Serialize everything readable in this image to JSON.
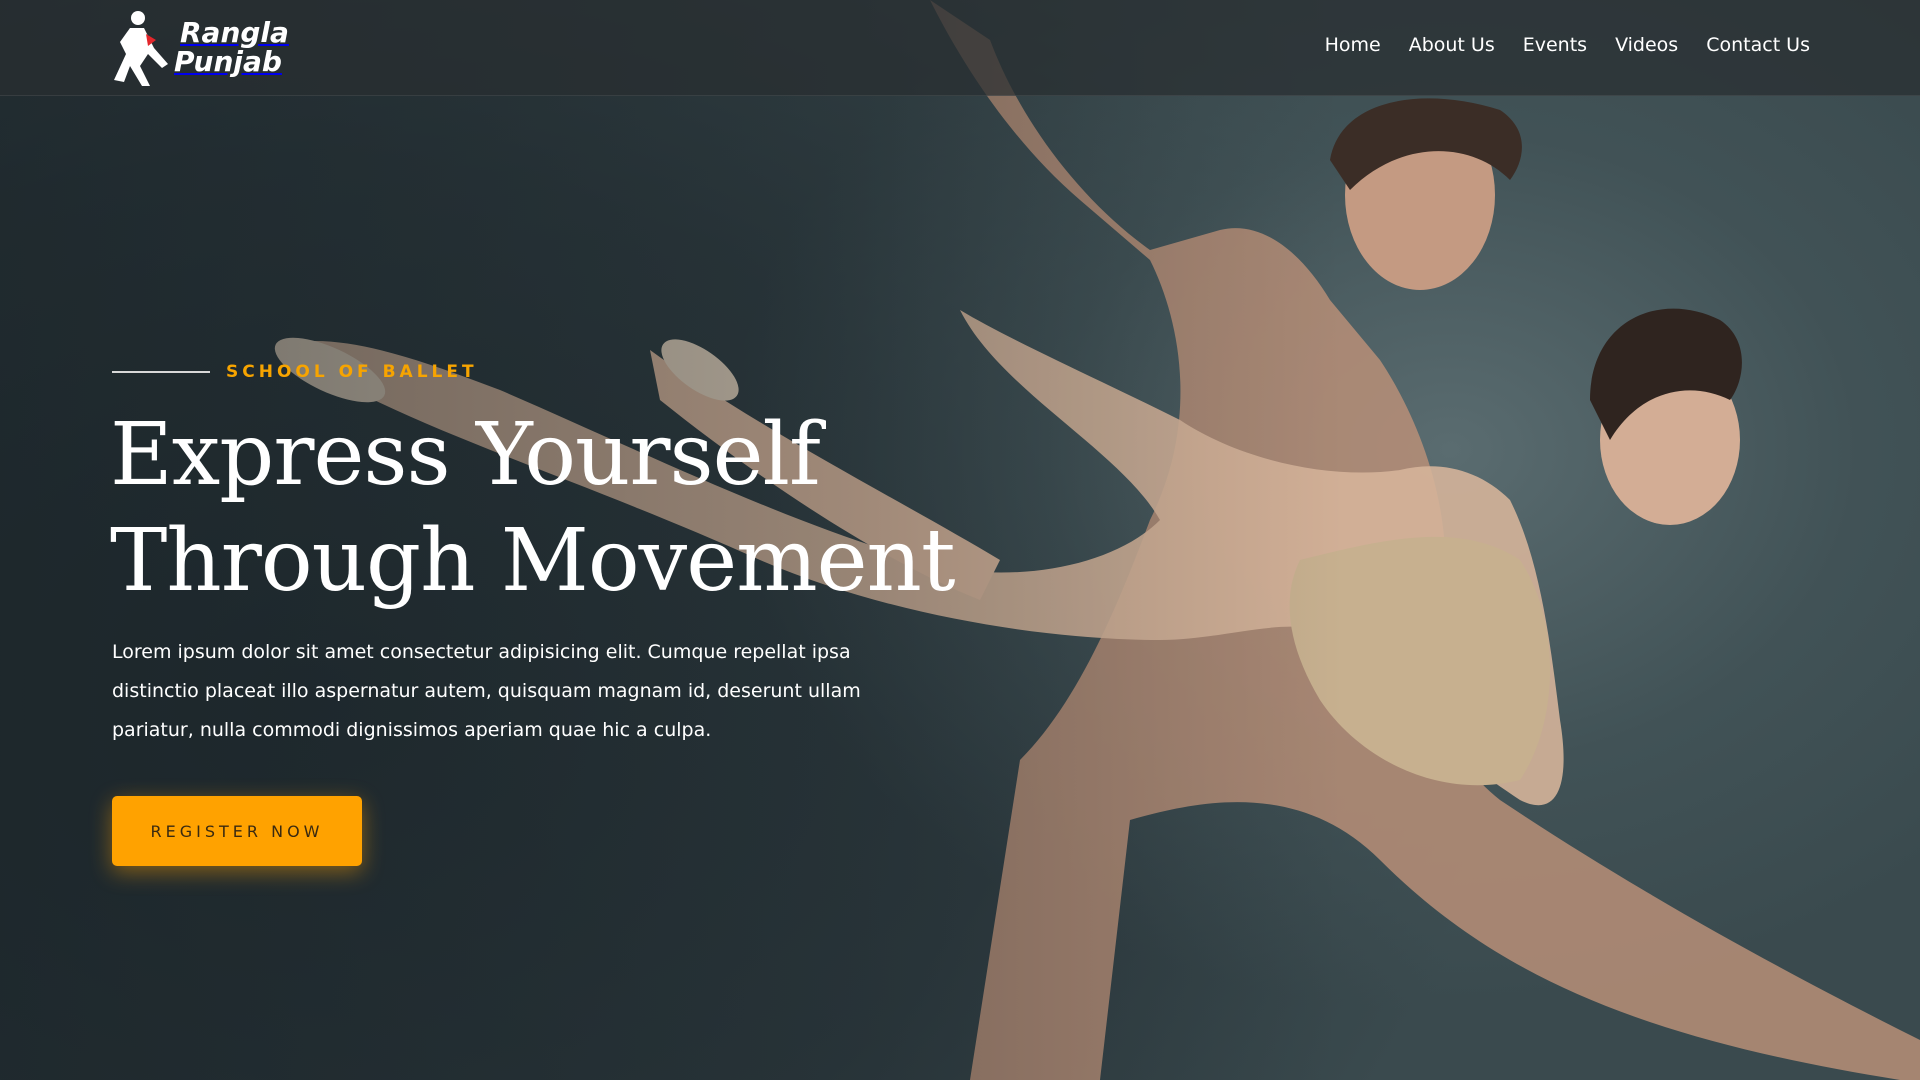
{
  "brand": {
    "name_line1": "Rangla",
    "name_line2": "Punjab",
    "logo_icon": "dancer-logo-icon"
  },
  "nav": {
    "items": [
      {
        "label": "Home"
      },
      {
        "label": "About Us"
      },
      {
        "label": "Events"
      },
      {
        "label": "Videos"
      },
      {
        "label": "Contact Us"
      }
    ]
  },
  "hero": {
    "eyebrow": "SCHOOL OF BALLET",
    "title_line1": "Express Yourself",
    "title_line2": "Through Movement",
    "body": "Lorem ipsum dolor sit amet consectetur adipisicing elit. Cumque repellat ipsa distinctio placeat illo aspernatur autem, quisquam magnam id, deserunt ullam pariatur, nulla commodi dignissimos aperiam quae hic a culpa.",
    "cta_label": "REGISTER NOW",
    "background_image": "ballet-dancers-photo"
  },
  "colors": {
    "accent": "#ffa200",
    "eyebrow": "#f7a400",
    "header_bg": "#282e30",
    "text": "#ffffff"
  }
}
